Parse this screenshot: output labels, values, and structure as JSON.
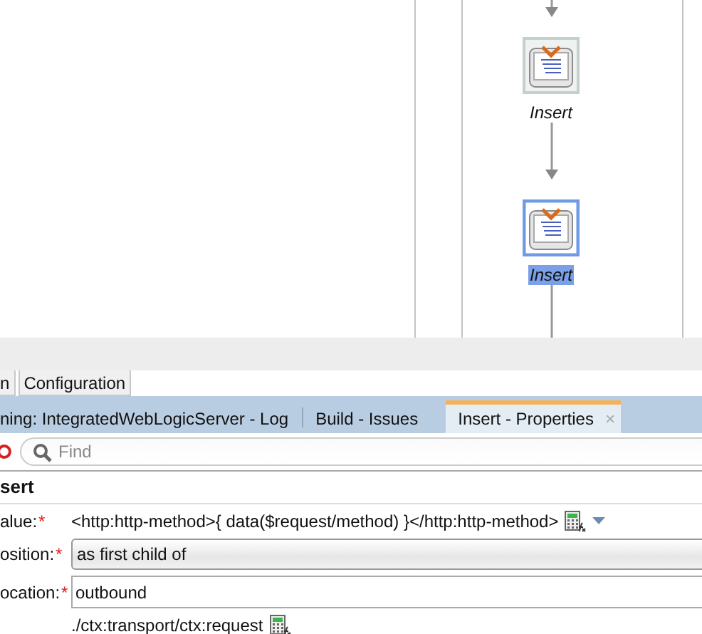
{
  "diagram": {
    "nodes": [
      {
        "label": "Insert",
        "selected": false
      },
      {
        "label": "Insert",
        "selected": true
      }
    ]
  },
  "editor_tabs": [
    {
      "label": "n",
      "selected": false
    },
    {
      "label": "Configuration",
      "selected": false
    }
  ],
  "panel_tabs": [
    {
      "label": "ning: IntegratedWebLogicServer - Log",
      "selected": false
    },
    {
      "label": "Build - Issues",
      "selected": false
    },
    {
      "label": "Insert - Properties",
      "selected": true,
      "close": "×"
    }
  ],
  "search": {
    "placeholder": "Find"
  },
  "properties": {
    "title": "sert",
    "fields": [
      {
        "kind": "text",
        "label": "alue:",
        "required_mark": "*",
        "value": "<http:http-method>{ data($request/method) }</http:http-method>"
      },
      {
        "kind": "combo",
        "label": "osition:",
        "required_mark": "*",
        "value": "as first child of"
      },
      {
        "kind": "input",
        "label": "ocation:",
        "required_mark": "*",
        "value": "outbound",
        "hint": "./ctx:transport/ctx:request"
      }
    ]
  }
}
